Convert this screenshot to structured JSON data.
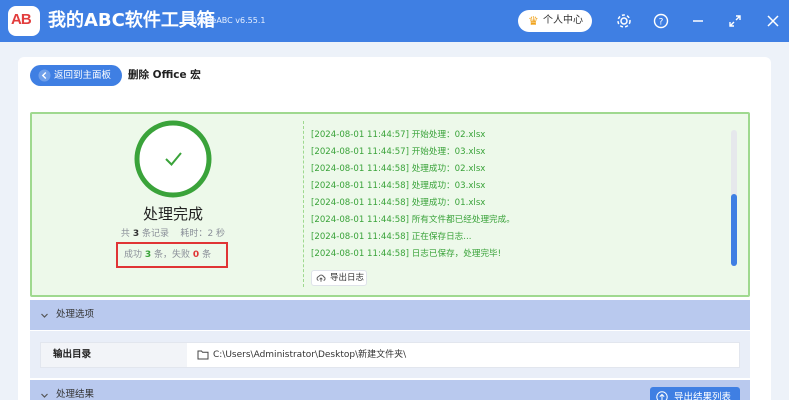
{
  "app": {
    "title": "我的ABC软件工具箱",
    "version": "WodeABC v6.55.1",
    "logo_text": "AB",
    "user_center_label": "个人中心",
    "icons": [
      "crown-icon",
      "gear-icon",
      "help-icon",
      "minimize-icon",
      "maximize-icon",
      "close-icon"
    ]
  },
  "nav": {
    "back_label": "返回到主面板",
    "page_title": "删除 Office 宏"
  },
  "result": {
    "status": "处理完成",
    "total_prefix": "共",
    "total_count": "3",
    "total_suffix": "条记录",
    "elapsed_label": "耗时：",
    "elapsed_value": "2",
    "elapsed_unit": "秒",
    "success_label": "成功",
    "success_count": "3",
    "success_unit": "条，失败",
    "fail_count": "0",
    "fail_unit": "条"
  },
  "log": {
    "lines": [
      "[2024-08-01 11:44:57] 开始处理：02.xlsx",
      "[2024-08-01 11:44:57] 开始处理：03.xlsx",
      "[2024-08-01 11:44:58] 处理成功：02.xlsx",
      "[2024-08-01 11:44:58] 处理成功：03.xlsx",
      "[2024-08-01 11:44:58] 处理成功：01.xlsx",
      "[2024-08-01 11:44:58] 所有文件都已经处理完成。",
      "[2024-08-01 11:44:58] 正在保存日志...",
      "[2024-08-01 11:44:58] 日志已保存，处理完毕!"
    ],
    "export_label": "导出日志",
    "scroll_position": 0.47
  },
  "options": {
    "section_label": "处理选项",
    "output_dir_label": "输出目录",
    "output_dir_value": "C:\\Users\\Administrator\\Desktop\\新建文件夹\\"
  },
  "results_section": {
    "section_label": "处理结果",
    "export_list_label": "导出结果列表"
  },
  "colors": {
    "accent": "#3f7fe3",
    "success": "#3aa33a",
    "success_bg": "#edf9ea",
    "error": "#e03535"
  }
}
